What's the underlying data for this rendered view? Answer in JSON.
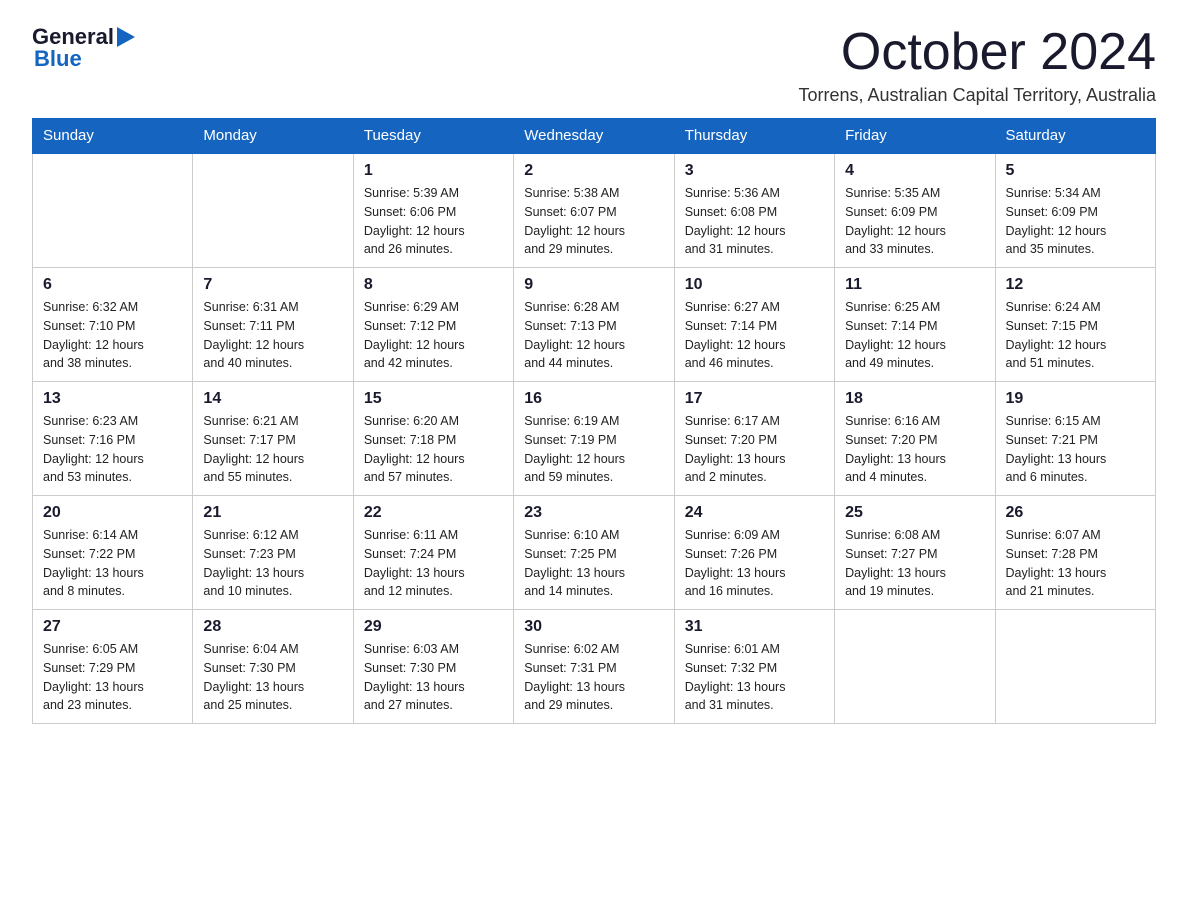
{
  "header": {
    "logo_general": "General",
    "logo_blue": "Blue",
    "month_title": "October 2024",
    "location": "Torrens, Australian Capital Territory, Australia"
  },
  "days_of_week": [
    "Sunday",
    "Monday",
    "Tuesday",
    "Wednesday",
    "Thursday",
    "Friday",
    "Saturday"
  ],
  "weeks": [
    [
      {
        "day": "",
        "info": ""
      },
      {
        "day": "",
        "info": ""
      },
      {
        "day": "1",
        "info": "Sunrise: 5:39 AM\nSunset: 6:06 PM\nDaylight: 12 hours\nand 26 minutes."
      },
      {
        "day": "2",
        "info": "Sunrise: 5:38 AM\nSunset: 6:07 PM\nDaylight: 12 hours\nand 29 minutes."
      },
      {
        "day": "3",
        "info": "Sunrise: 5:36 AM\nSunset: 6:08 PM\nDaylight: 12 hours\nand 31 minutes."
      },
      {
        "day": "4",
        "info": "Sunrise: 5:35 AM\nSunset: 6:09 PM\nDaylight: 12 hours\nand 33 minutes."
      },
      {
        "day": "5",
        "info": "Sunrise: 5:34 AM\nSunset: 6:09 PM\nDaylight: 12 hours\nand 35 minutes."
      }
    ],
    [
      {
        "day": "6",
        "info": "Sunrise: 6:32 AM\nSunset: 7:10 PM\nDaylight: 12 hours\nand 38 minutes."
      },
      {
        "day": "7",
        "info": "Sunrise: 6:31 AM\nSunset: 7:11 PM\nDaylight: 12 hours\nand 40 minutes."
      },
      {
        "day": "8",
        "info": "Sunrise: 6:29 AM\nSunset: 7:12 PM\nDaylight: 12 hours\nand 42 minutes."
      },
      {
        "day": "9",
        "info": "Sunrise: 6:28 AM\nSunset: 7:13 PM\nDaylight: 12 hours\nand 44 minutes."
      },
      {
        "day": "10",
        "info": "Sunrise: 6:27 AM\nSunset: 7:14 PM\nDaylight: 12 hours\nand 46 minutes."
      },
      {
        "day": "11",
        "info": "Sunrise: 6:25 AM\nSunset: 7:14 PM\nDaylight: 12 hours\nand 49 minutes."
      },
      {
        "day": "12",
        "info": "Sunrise: 6:24 AM\nSunset: 7:15 PM\nDaylight: 12 hours\nand 51 minutes."
      }
    ],
    [
      {
        "day": "13",
        "info": "Sunrise: 6:23 AM\nSunset: 7:16 PM\nDaylight: 12 hours\nand 53 minutes."
      },
      {
        "day": "14",
        "info": "Sunrise: 6:21 AM\nSunset: 7:17 PM\nDaylight: 12 hours\nand 55 minutes."
      },
      {
        "day": "15",
        "info": "Sunrise: 6:20 AM\nSunset: 7:18 PM\nDaylight: 12 hours\nand 57 minutes."
      },
      {
        "day": "16",
        "info": "Sunrise: 6:19 AM\nSunset: 7:19 PM\nDaylight: 12 hours\nand 59 minutes."
      },
      {
        "day": "17",
        "info": "Sunrise: 6:17 AM\nSunset: 7:20 PM\nDaylight: 13 hours\nand 2 minutes."
      },
      {
        "day": "18",
        "info": "Sunrise: 6:16 AM\nSunset: 7:20 PM\nDaylight: 13 hours\nand 4 minutes."
      },
      {
        "day": "19",
        "info": "Sunrise: 6:15 AM\nSunset: 7:21 PM\nDaylight: 13 hours\nand 6 minutes."
      }
    ],
    [
      {
        "day": "20",
        "info": "Sunrise: 6:14 AM\nSunset: 7:22 PM\nDaylight: 13 hours\nand 8 minutes."
      },
      {
        "day": "21",
        "info": "Sunrise: 6:12 AM\nSunset: 7:23 PM\nDaylight: 13 hours\nand 10 minutes."
      },
      {
        "day": "22",
        "info": "Sunrise: 6:11 AM\nSunset: 7:24 PM\nDaylight: 13 hours\nand 12 minutes."
      },
      {
        "day": "23",
        "info": "Sunrise: 6:10 AM\nSunset: 7:25 PM\nDaylight: 13 hours\nand 14 minutes."
      },
      {
        "day": "24",
        "info": "Sunrise: 6:09 AM\nSunset: 7:26 PM\nDaylight: 13 hours\nand 16 minutes."
      },
      {
        "day": "25",
        "info": "Sunrise: 6:08 AM\nSunset: 7:27 PM\nDaylight: 13 hours\nand 19 minutes."
      },
      {
        "day": "26",
        "info": "Sunrise: 6:07 AM\nSunset: 7:28 PM\nDaylight: 13 hours\nand 21 minutes."
      }
    ],
    [
      {
        "day": "27",
        "info": "Sunrise: 6:05 AM\nSunset: 7:29 PM\nDaylight: 13 hours\nand 23 minutes."
      },
      {
        "day": "28",
        "info": "Sunrise: 6:04 AM\nSunset: 7:30 PM\nDaylight: 13 hours\nand 25 minutes."
      },
      {
        "day": "29",
        "info": "Sunrise: 6:03 AM\nSunset: 7:30 PM\nDaylight: 13 hours\nand 27 minutes."
      },
      {
        "day": "30",
        "info": "Sunrise: 6:02 AM\nSunset: 7:31 PM\nDaylight: 13 hours\nand 29 minutes."
      },
      {
        "day": "31",
        "info": "Sunrise: 6:01 AM\nSunset: 7:32 PM\nDaylight: 13 hours\nand 31 minutes."
      },
      {
        "day": "",
        "info": ""
      },
      {
        "day": "",
        "info": ""
      }
    ]
  ]
}
